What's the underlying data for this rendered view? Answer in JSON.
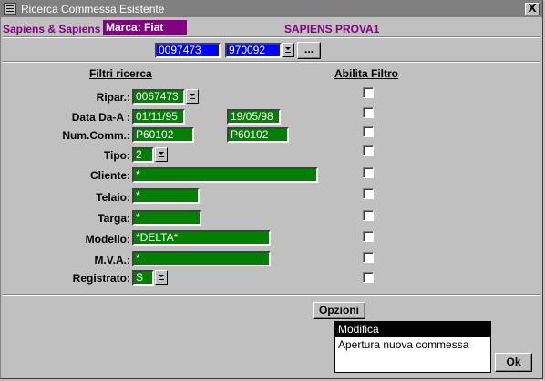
{
  "window": {
    "title": "Ricerca Commessa Esistente",
    "close_label": "X"
  },
  "header": {
    "company": "Sapiens & Sapiens",
    "brand": "Marca: Fiat",
    "center_title": "SAPIENS PROVA1"
  },
  "top_fields": {
    "code1": "0097473",
    "code2": "970092",
    "browse_label": "..."
  },
  "section": {
    "filters_title": "Filtri ricerca",
    "enable_title": "Abilita Filtro"
  },
  "filters": {
    "ripar": {
      "label": "Ripar.:",
      "value": "0067473"
    },
    "data": {
      "label": "Data Da-A :",
      "from": "01/11/95",
      "to": "19/05/98"
    },
    "numcomm": {
      "label": "Num.Comm.:",
      "from": "P60102",
      "to": "P60102"
    },
    "tipo": {
      "label": "Tipo:",
      "value": "2"
    },
    "cliente": {
      "label": "Cliente:",
      "value": "*"
    },
    "telaio": {
      "label": "Telaio:",
      "value": "*"
    },
    "targa": {
      "label": "Targa:",
      "value": "*"
    },
    "modello": {
      "label": "Modello:",
      "value": "*DELTA*"
    },
    "mva": {
      "label": "M.V.A.:",
      "value": "*"
    },
    "registrato": {
      "label": "Registrato:",
      "value": "S"
    }
  },
  "options": {
    "button_label": "Opzioni",
    "items": [
      "Modifica",
      "Apertura nuova commessa"
    ],
    "selected": "Modifica"
  },
  "footer": {
    "ok_label": "Ok"
  }
}
